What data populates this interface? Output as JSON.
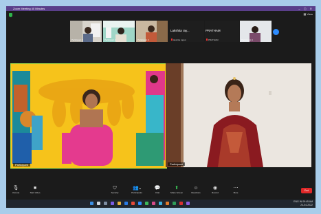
{
  "window": {
    "title": "Zoom Meeting 40 Minutes",
    "view_label": "View"
  },
  "thumbnails": [
    {
      "name": "Participant 1"
    },
    {
      "name": "Participant 2"
    },
    {
      "name": "Participant 3"
    }
  ],
  "name_only_tiles": [
    {
      "big": "Lakshita ray...",
      "name": "lakshita rajput"
    },
    {
      "big": "PRATHAM",
      "name": "PRATHAM"
    }
  ],
  "video_thumb_4": {
    "name": "Participant 4"
  },
  "main_tiles": {
    "left_name": "Participant",
    "right_name": "Participant"
  },
  "controls": {
    "unmute": "Unmute",
    "start_video": "Start Video",
    "security": "Security",
    "participants": "Participants",
    "participants_count": "13",
    "chat": "Chat",
    "share_screen": "Share Screen",
    "reactions": "Reactions",
    "record": "Record",
    "more": "More",
    "end": "End"
  },
  "taskbar": {
    "time": "09:45 AM",
    "date": "24-04-2022",
    "lang": "ENG IN"
  },
  "colors": {
    "accent": "#2d8cff",
    "end": "#e02828",
    "title_bar": "#5a3f8a"
  }
}
